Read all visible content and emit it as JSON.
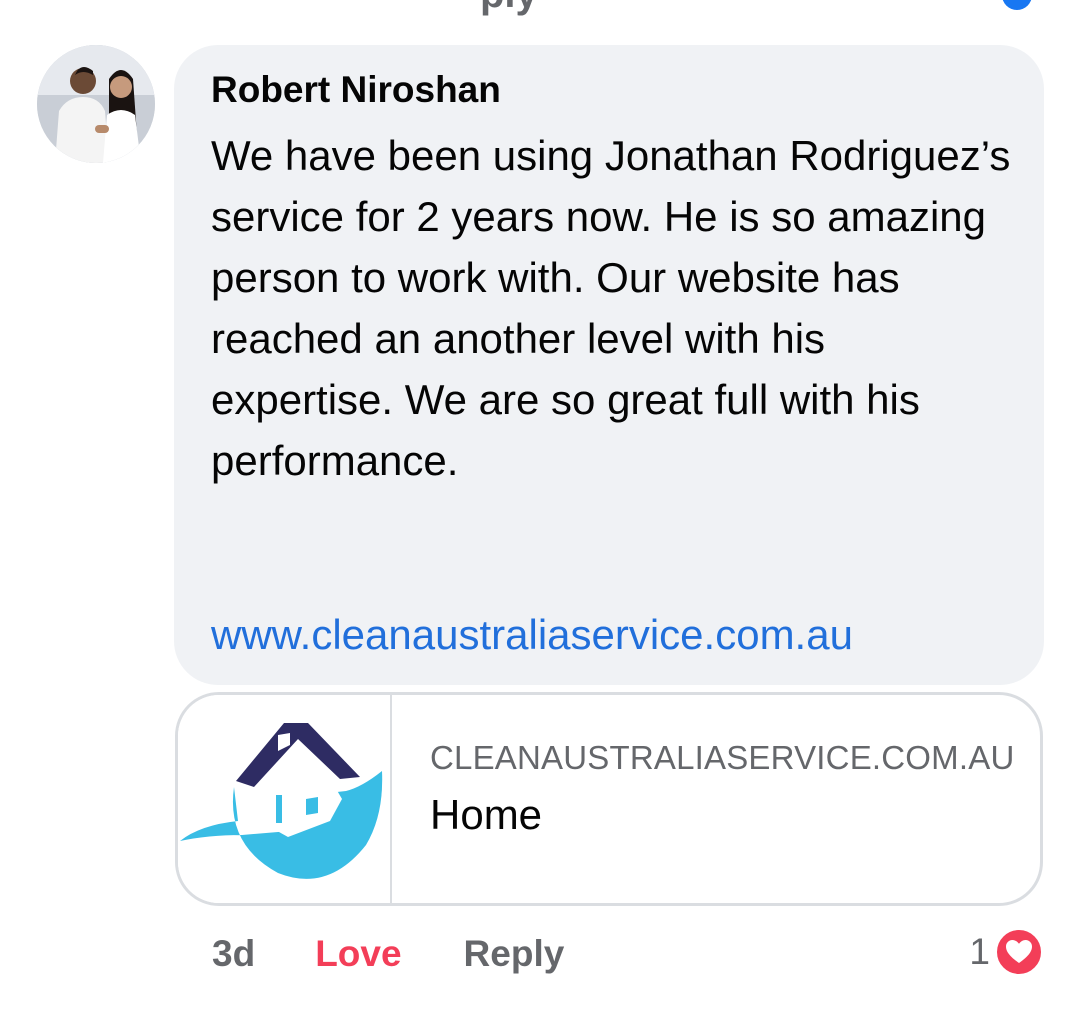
{
  "comment": {
    "author": "Robert Niroshan",
    "text": "We have been using Jonathan Rodriguez’s service for 2 years now. He is so amazing person to work with. Our website has reached an another level with his expertise. We are so great full with his performance.",
    "link": "www.cleanaustraliaservice.com.au",
    "avatar_icon": "profile-photo"
  },
  "preview": {
    "domain": "CLEANAUSTRALIASERVICE.COM.AU",
    "title": "Home",
    "thumbnail_icon": "house-logo-icon",
    "colors": {
      "roof": "#2e2c63",
      "wave": "#39bde5"
    }
  },
  "actions": {
    "time": "3d",
    "love_label": "Love",
    "reply_label": "Reply"
  },
  "reactions": {
    "count": "1",
    "icon": "heart-icon",
    "color": "#f33e58"
  }
}
